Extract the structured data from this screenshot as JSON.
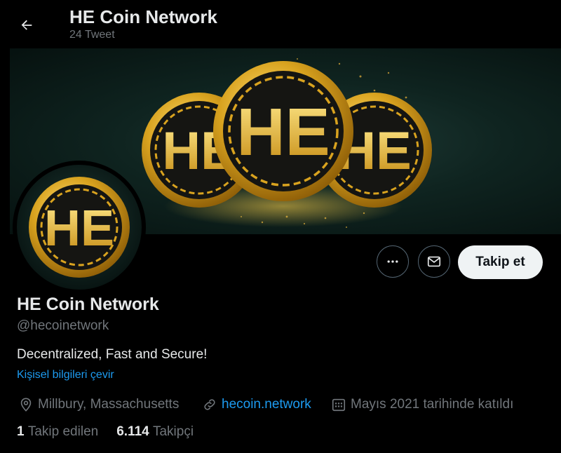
{
  "header": {
    "title": "HE Coin Network",
    "subtitle": "24 Tweet"
  },
  "banner": {
    "logo_text": "HE",
    "colors": {
      "gold": "#d4a21c",
      "background": "#0f2420"
    }
  },
  "profile": {
    "name": "HE Coin Network",
    "handle": "@hecoinetwork",
    "bio": "Decentralized, Fast and Secure!",
    "translate_label": "Kişisel bilgileri çevir",
    "location": "Millbury, Massachusetts",
    "website": "hecoin.network",
    "joined": "Mayıs 2021 tarihinde katıldı",
    "following_count": "1",
    "following_label": "Takip edilen",
    "followers_count": "6.114",
    "followers_label": "Takipçi"
  },
  "actions": {
    "follow_label": "Takip et",
    "more_icon": "more-icon",
    "message_icon": "mail-icon"
  },
  "icons": [
    "back-arrow-icon",
    "location-icon",
    "link-icon",
    "calendar-icon"
  ]
}
